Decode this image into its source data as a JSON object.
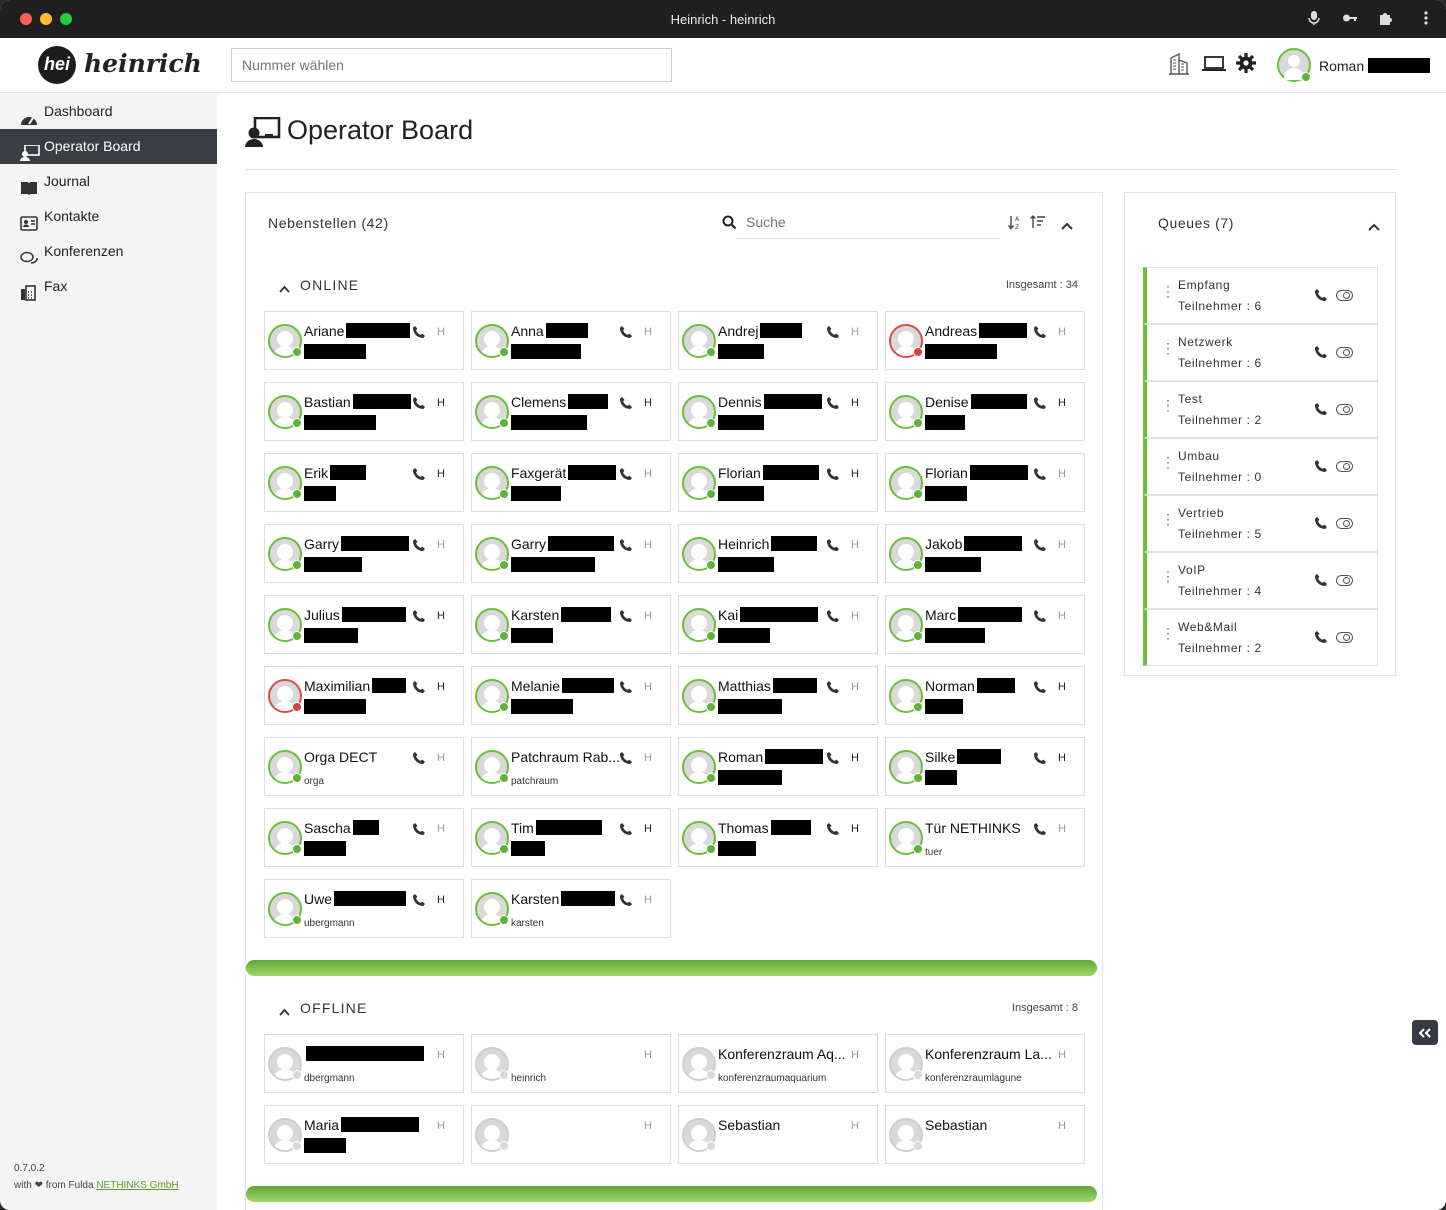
{
  "window": {
    "title": "Heinrich - heinrich"
  },
  "header": {
    "logo_mark": "hei",
    "logo_text": "heinrich",
    "dial_placeholder": "Nummer wählen",
    "user_name": "Roman"
  },
  "sidebar": {
    "items": [
      {
        "label": "Dashboard",
        "icon": "dashboard-icon"
      },
      {
        "label": "Operator Board",
        "icon": "operator-board-icon"
      },
      {
        "label": "Journal",
        "icon": "book-icon"
      },
      {
        "label": "Kontakte",
        "icon": "contact-card-icon"
      },
      {
        "label": "Konferenzen",
        "icon": "chat-bubbles-icon"
      },
      {
        "label": "Fax",
        "icon": "fax-icon"
      }
    ],
    "version": "0.7.0.2",
    "credit_prefix": "with",
    "credit_middle": "from Fulda",
    "credit_link": "NETHINKS GmbH"
  },
  "page": {
    "title": "Operator Board"
  },
  "extensions": {
    "header": "Nebenstellen (42)",
    "search_placeholder": "Suche",
    "online": {
      "label": "ONLINE",
      "total": "Insgesamt : 34",
      "cards": [
        {
          "name": "Ariane",
          "sub": "",
          "status": "online",
          "hkey": false
        },
        {
          "name": "Anna",
          "sub": "",
          "status": "online",
          "hkey": false
        },
        {
          "name": "Andrej",
          "sub": "",
          "status": "online",
          "hkey": false
        },
        {
          "name": "Andreas",
          "sub": "",
          "status": "busy",
          "hkey": false
        },
        {
          "name": "Bastian",
          "sub": "",
          "status": "online",
          "hkey": true
        },
        {
          "name": "Clemens",
          "sub": "",
          "status": "online",
          "hkey": true
        },
        {
          "name": "Dennis",
          "sub": "",
          "status": "online",
          "hkey": true
        },
        {
          "name": "Denise",
          "sub": "",
          "status": "online",
          "hkey": true
        },
        {
          "name": "Erik",
          "sub": "",
          "status": "online",
          "hkey": true
        },
        {
          "name": "Faxgerät",
          "sub": "",
          "status": "online",
          "hkey": false
        },
        {
          "name": "Florian",
          "sub": "",
          "status": "online",
          "hkey": true
        },
        {
          "name": "Florian",
          "sub": "",
          "status": "online",
          "hkey": false
        },
        {
          "name": "Garry",
          "sub": "",
          "status": "online",
          "hkey": false
        },
        {
          "name": "Garry",
          "sub": "",
          "status": "online",
          "hkey": false
        },
        {
          "name": "Heinrich",
          "sub": "",
          "status": "online",
          "hkey": false
        },
        {
          "name": "Jakob",
          "sub": "",
          "status": "online",
          "hkey": false
        },
        {
          "name": "Julius",
          "sub": "",
          "status": "online",
          "hkey": true
        },
        {
          "name": "Karsten",
          "sub": "",
          "status": "online",
          "hkey": false
        },
        {
          "name": "Kai",
          "sub": "",
          "status": "online",
          "hkey": false
        },
        {
          "name": "Marc",
          "sub": "",
          "status": "online",
          "hkey": false
        },
        {
          "name": "Maximilian",
          "sub": "",
          "status": "busy",
          "hkey": true
        },
        {
          "name": "Melanie",
          "sub": "",
          "status": "online",
          "hkey": false
        },
        {
          "name": "Matthias",
          "sub": "",
          "status": "online",
          "hkey": false
        },
        {
          "name": "Norman",
          "sub": "",
          "status": "online",
          "hkey": true
        },
        {
          "name": "Orga DECT",
          "sub": "orga",
          "status": "online",
          "hkey": false
        },
        {
          "name": "Patchraum Rab...",
          "sub": "patchraum",
          "status": "online",
          "hkey": false
        },
        {
          "name": "Roman",
          "sub": "",
          "status": "online",
          "hkey": true
        },
        {
          "name": "Silke",
          "sub": "",
          "status": "online",
          "hkey": true
        },
        {
          "name": "Sascha",
          "sub": "",
          "status": "online",
          "hkey": false
        },
        {
          "name": "Tim",
          "sub": "",
          "status": "online",
          "hkey": true
        },
        {
          "name": "Thomas",
          "sub": "",
          "status": "online",
          "hkey": true
        },
        {
          "name": "Tür NETHINKS",
          "sub": "tuer",
          "status": "online",
          "hkey": false
        },
        {
          "name": "Uwe",
          "sub": "ubergmann",
          "status": "online",
          "hkey": true
        },
        {
          "name": "Karsten",
          "sub": "karsten",
          "status": "online",
          "hkey": false
        }
      ]
    },
    "offline": {
      "label": "OFFLINE",
      "total": "Insgesamt : 8",
      "cards": [
        {
          "name": "",
          "sub": "dbergmann",
          "status": "offline",
          "hkey": false
        },
        {
          "name": "",
          "sub": "heinrich",
          "status": "offline",
          "hkey": false
        },
        {
          "name": "Konferenzraum Aq...",
          "sub": "konferenzraumaquarium",
          "status": "offline",
          "hkey": false
        },
        {
          "name": "Konferenzraum La...",
          "sub": "konferenzraumlagune",
          "status": "offline",
          "hkey": false
        },
        {
          "name": "Maria",
          "sub": "",
          "status": "offline",
          "hkey": false
        },
        {
          "name": "",
          "sub": "",
          "status": "offline",
          "hkey": false
        },
        {
          "name": "Sebastian",
          "sub": "",
          "status": "offline",
          "hkey": false
        },
        {
          "name": "Sebastian",
          "sub": "",
          "status": "offline",
          "hkey": false
        }
      ]
    },
    "hkey_label": "H"
  },
  "queues": {
    "header": "Queues (7)",
    "items": [
      {
        "name": "Empfang",
        "members": "Teilnehmer : 6"
      },
      {
        "name": "Netzwerk",
        "members": "Teilnehmer : 6"
      },
      {
        "name": "Test",
        "members": "Teilnehmer : 2"
      },
      {
        "name": "Umbau",
        "members": "Teilnehmer : 0"
      },
      {
        "name": "Vertrieb",
        "members": "Teilnehmer : 5"
      },
      {
        "name": "VoIP",
        "members": "Teilnehmer : 4"
      },
      {
        "name": "Web&Mail",
        "members": "Teilnehmer : 2"
      }
    ]
  },
  "colors": {
    "accent": "#6bbf3a",
    "busy": "#d8413f",
    "sidebar_active": "#3a3d43"
  }
}
